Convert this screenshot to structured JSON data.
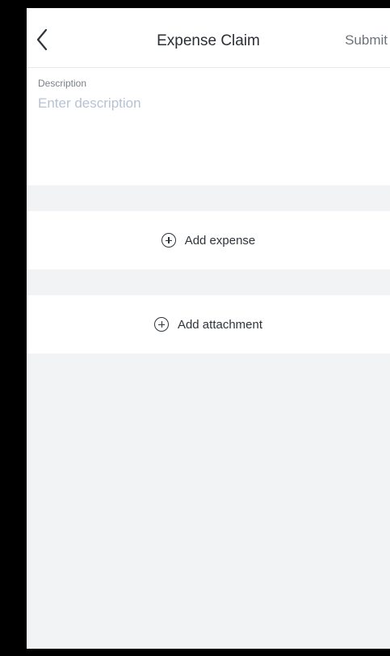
{
  "header": {
    "title": "Expense Claim",
    "back_icon": "chevron-left-icon",
    "submit_label": "Submit"
  },
  "description": {
    "label": "Description",
    "placeholder": "Enter description",
    "value": ""
  },
  "actions": {
    "add_expense_label": "Add expense",
    "add_attachment_label": "Add attachment",
    "icon": "plus-circle-icon"
  },
  "colors": {
    "background": "#f2f3f5",
    "surface": "#ffffff",
    "text_primary": "#2b2f36",
    "text_secondary": "#6e737b",
    "placeholder": "#b7c3d2",
    "frame": "#000000"
  }
}
